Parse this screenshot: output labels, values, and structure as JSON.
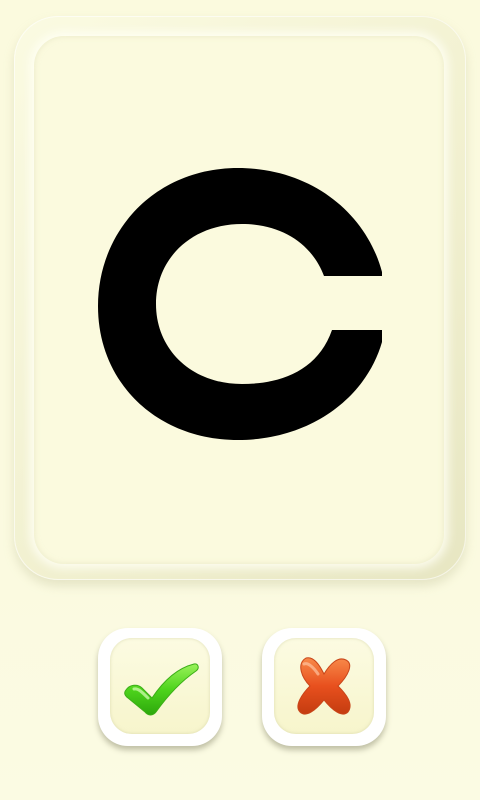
{
  "flashcard": {
    "letter": "c",
    "letter_color": "#000000",
    "card_color": "#fbfade"
  },
  "controls": {
    "correct_icon": "check-icon",
    "correct_color": "#5ddb2a",
    "wrong_icon": "cross-icon",
    "wrong_color": "#e8501e"
  }
}
